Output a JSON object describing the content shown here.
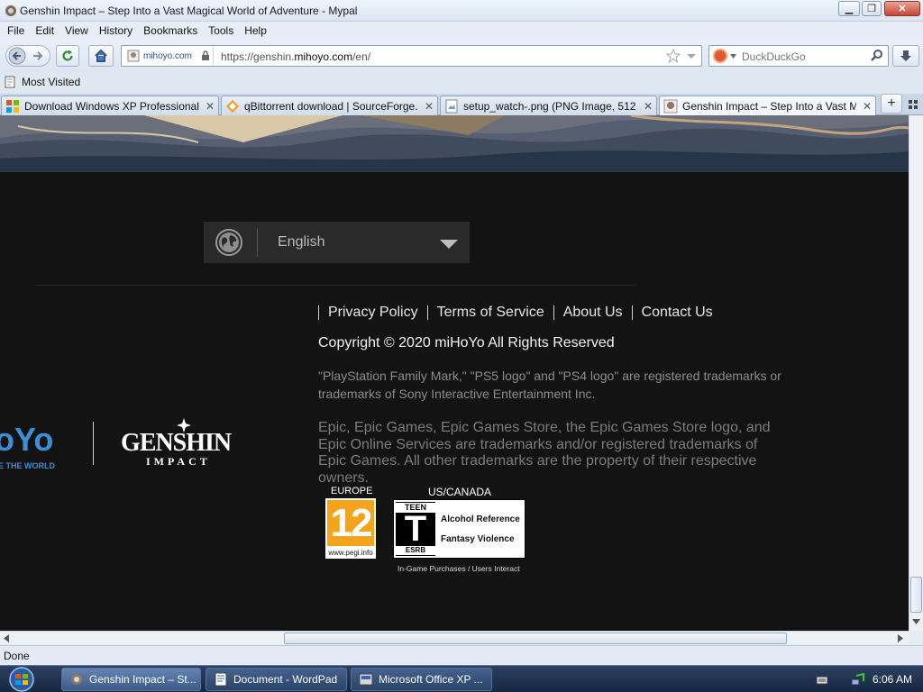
{
  "window": {
    "title": "Genshin Impact – Step Into a Vast Magical World of Adventure - Mypal",
    "min_label": "▁",
    "max_label": "❐",
    "close_label": "✕"
  },
  "menu": {
    "items": [
      "File",
      "Edit",
      "View",
      "History",
      "Bookmarks",
      "Tools",
      "Help"
    ]
  },
  "nav": {
    "site_identity": "mihoyo.com",
    "url_prefix": "https://genshin.",
    "url_domain": "mihoyo.com",
    "url_suffix": "/en/",
    "search_placeholder": "DuckDuckGo"
  },
  "bookmarks": {
    "most_visited": "Most Visited"
  },
  "tabs": [
    {
      "label": "Download Windows XP Professional ...",
      "icon": "windows-icon"
    },
    {
      "label": "qBittorrent download | SourceForge....",
      "icon": "sourceforge-icon"
    },
    {
      "label": "setup_watch-.png (PNG Image, 512 ×...",
      "icon": "image-icon"
    },
    {
      "label": "Genshin Impact – Step Into a Vast M...",
      "icon": "mihoyo-icon"
    }
  ],
  "page": {
    "language": "English",
    "footer_links": [
      "Privacy Policy",
      "Terms of Service",
      "About Us",
      "Contact Us"
    ],
    "copyright": "Copyright © 2020 miHoYo All Rights Reserved",
    "trademark_sony": "\"PlayStation Family Mark,\" \"PS5 logo\" and \"PS4 logo\" are registered trademarks or trademarks of Sony Interactive Entertainment Inc.",
    "trademark_epic": "Epic, Epic Games, Epic Games Store, the Epic Games Store logo, and Epic Online Services are trademarks and/or registered trademarks of Epic Games. All other trademarks are the property of their respective owners.",
    "logo_mihoyo_text": "oYo",
    "logo_mihoyo_sub": "E THE WORLD",
    "logo_genshin_text": "GENSHIN",
    "logo_genshin_sub": "IMPACT",
    "rating_europe_label": "EUROPE",
    "rating_us_label": "US/CANADA",
    "pegi_number": "12",
    "pegi_url": "www.pegi.info",
    "esrb_teen": "TEEN",
    "esrb_letter": "T",
    "esrb_word": "ESRB",
    "esrb_descriptors": [
      "Alcohol Reference",
      "Fantasy Violence"
    ],
    "esrb_footer": "In-Game Purchases / Users Interact"
  },
  "status": {
    "text": "Done"
  },
  "taskbar": {
    "items": [
      {
        "label": "Genshin Impact – St...",
        "active": true
      },
      {
        "label": "Document - WordPad",
        "active": false
      },
      {
        "label": "Microsoft Office XP ...",
        "active": false
      }
    ],
    "clock": "6:06 AM"
  },
  "colors": {
    "page_background": "#131313",
    "pegi_orange": "#f4a41a",
    "mihoyo_blue": "#3a8fd6",
    "taskbar": "#1e3352"
  }
}
